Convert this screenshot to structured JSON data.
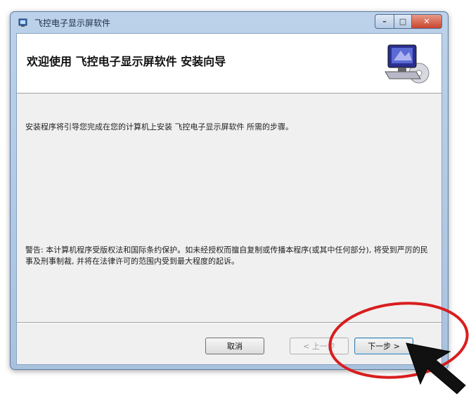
{
  "window": {
    "title": "飞控电子显示屏软件",
    "minimize_glyph": "–",
    "maximize_glyph": "□",
    "close_glyph": "✕"
  },
  "header": {
    "title": "欢迎使用 飞控电子显示屏软件 安装向导",
    "art_icon": "installer-computer-cd-icon"
  },
  "body": {
    "intro": "安装程序将引导您完成在您的计算机上安装 飞控电子显示屏软件 所需的步骤。",
    "warning": "警告: 本计算机程序受版权法和国际条约保护。如未经授权而擅自复制或传播本程序(或其中任何部分), 将受到严厉的民事及刑事制裁, 并将在法律许可的范围内受到最大程度的起诉。"
  },
  "buttons": {
    "cancel": "取消",
    "back": "< 上一步",
    "next": "下一步 >"
  },
  "annotation": {
    "highlight_color": "#d91e1e",
    "pointer_color": "#111111"
  }
}
